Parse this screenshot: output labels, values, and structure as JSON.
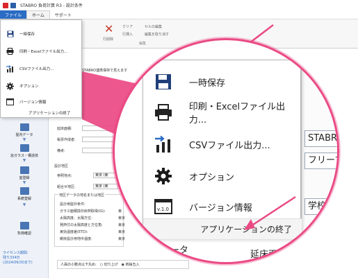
{
  "titlebar": {
    "title": "STABRO 負荷計算 R3 - 設計条件"
  },
  "menubar": {
    "file": "ファイル",
    "home": "ホーム",
    "support": "サポート"
  },
  "ribbon": {
    "delete": "行削除",
    "clear": "クリア",
    "cell_edit": "セルの編集",
    "insert": "行挿入",
    "reedit": "編集を取り消す",
    "group": "編集"
  },
  "sidebar": {
    "items": [
      {
        "label": "屋内データ"
      },
      {
        "label": "窓ガラス・構造体"
      },
      {
        "label": "室登録"
      },
      {
        "label": "系統登録"
      },
      {
        "label": "負荷確認"
      }
    ],
    "license": [
      "ライセンス期間:",
      "残り334日",
      "(2024/06/30まで)"
    ]
  },
  "content": {
    "stabro_label": "STABRO連携保存で見えます",
    "fields": [
      {
        "label": "延床面積:"
      },
      {
        "label": "帳票作成者:"
      },
      {
        "label": "備考:"
      }
    ],
    "region_title": "設計地区",
    "region_ref": "参照地点:",
    "region_ref_val": "東京 (東",
    "region_comb": "組合せ地区:",
    "region_comb_val": "東京 (東",
    "outdoor_title": "地区データの地名または地区",
    "outdoor_rows": [
      {
        "label": "設計用屋外条件:",
        "value": ""
      },
      {
        "label": "ガラス面積換日射熱取得(IG):",
        "value": "東"
      },
      {
        "label": "太陽高度、太陽方位:",
        "value": "東京"
      },
      {
        "label": "発熱付の太陽高度と方位角:",
        "value": "東京"
      },
      {
        "label": "実効温度差(ETD):",
        "value": "東京"
      },
      {
        "label": "暖房設計用地中温度:",
        "value": "東京"
      }
    ],
    "rounding_label": "人員の小数点以下丸め:",
    "round_down": "切り上げ",
    "round_half": "四捨五入"
  },
  "filemenu": {
    "items": [
      {
        "label": "一時保存"
      },
      {
        "label": "印刷・Excelファイル出力..."
      },
      {
        "label": "CSVファイル出力..."
      },
      {
        "label": "オプション"
      },
      {
        "label": "バージョン情報"
      }
    ],
    "exit": "アプリケーションの終了"
  },
  "lens": {
    "items": [
      {
        "label": "一時保存"
      },
      {
        "label": "印刷・Excelファイル出力..."
      },
      {
        "label": "CSVファイル出力..."
      },
      {
        "label": "オプション"
      },
      {
        "label": "バージョン情報"
      }
    ],
    "exit": "アプリケーションの終了",
    "right_boxes": [
      "STABRO",
      "フリープラ",
      "学校"
    ],
    "below_left": "ータ",
    "below_right": "延床面",
    "version_badge": "v.1.0"
  },
  "colors": {
    "accent": "#ea4a84",
    "brand": "#2b6cc4",
    "icon": "#1f3f7a",
    "gear": "#1b1b1b"
  }
}
